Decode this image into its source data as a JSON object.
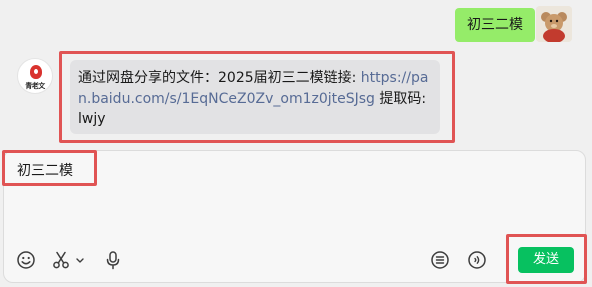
{
  "outgoing_message": {
    "text": "初三二模"
  },
  "incoming_message": {
    "prefix": "通过网盘分享的文件：2025届初三二模链接: ",
    "link": "https://pan.baidu.com/s/1EqNCeZ0Zv_om1z0jteSJsg",
    "suffix": " 提取码: lwjy"
  },
  "peer_avatar": {
    "logo_text": "青老文"
  },
  "composer": {
    "value": "初三二模"
  },
  "toolbar": {
    "icons": [
      "emoji-icon",
      "scissors-icon",
      "chevron-down-icon",
      "microphone-icon",
      "chat-history-icon",
      "voice-message-icon"
    ],
    "send_label": "发送"
  },
  "colors": {
    "outgoing_bubble": "#95ec69",
    "incoming_bubble": "#e2e2e4",
    "link": "#576b95",
    "send_button": "#07c160",
    "highlight": "#e05454"
  }
}
